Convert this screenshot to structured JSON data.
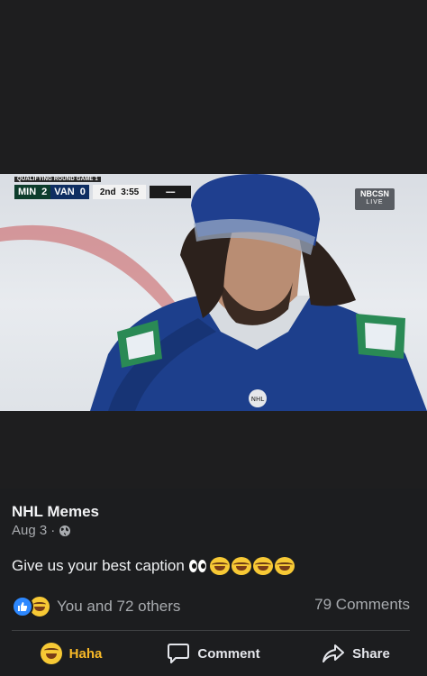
{
  "video": {
    "scorebug": {
      "round_label": "QUALIFYING ROUND GAME 1",
      "team1": "MIN",
      "team1_score": "2",
      "team2": "VAN",
      "team2_score": "0",
      "period": "2nd",
      "clock": "3:55"
    },
    "network": "NBCSN",
    "network_status": "LIVE"
  },
  "post": {
    "page_name": "NHL Memes",
    "date": "Aug 3",
    "privacy_icon": "globe-icon",
    "caption_text": "Give us your best caption",
    "caption_emojis": [
      "eyes-emoji",
      "laughing-tears-emoji",
      "laughing-tears-emoji",
      "laughing-tears-emoji",
      "laughing-tears-emoji"
    ]
  },
  "engagement": {
    "reaction_icons": [
      "like-reaction-icon",
      "haha-reaction-icon"
    ],
    "reactions_text": "You and 72 others",
    "comments_text": "79 Comments"
  },
  "actions": {
    "haha_label": "Haha",
    "comment_label": "Comment",
    "share_label": "Share"
  },
  "colors": {
    "background": "#242526",
    "post_background": "#1c1d1f",
    "haha_active": "#f7b928",
    "like_blue": "#2d88ff"
  }
}
